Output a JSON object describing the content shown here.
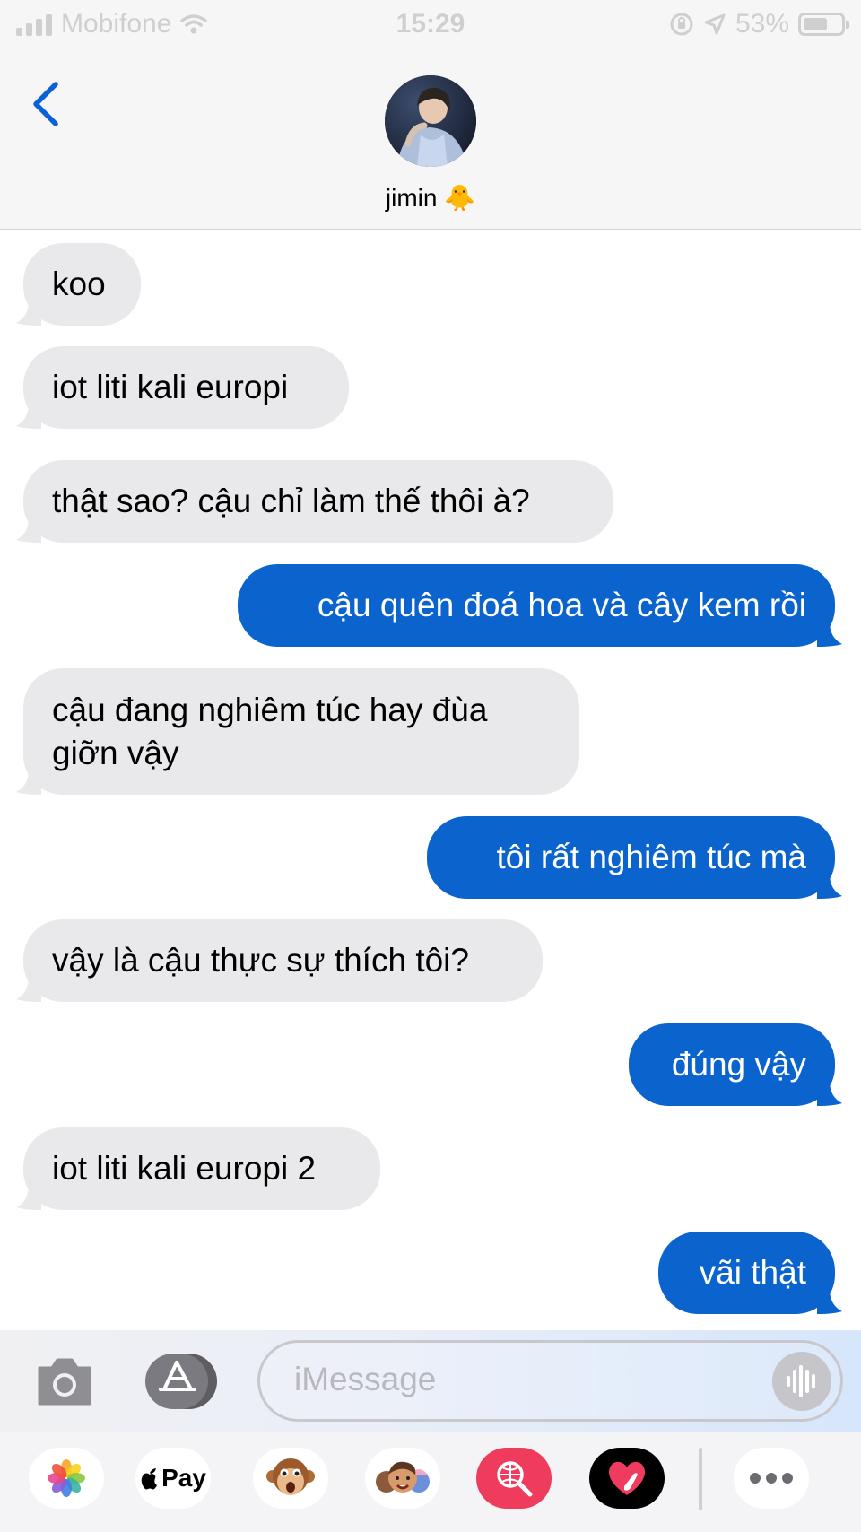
{
  "status_bar": {
    "carrier": "Mobifone",
    "time": "15:29",
    "battery": "53%"
  },
  "header": {
    "contact_name": "jimin 🐥"
  },
  "messages": [
    {
      "direction": "incoming",
      "text": "koo"
    },
    {
      "direction": "incoming",
      "text": "iot liti kali europi"
    },
    {
      "direction": "incoming",
      "text": "thật sao? cậu chỉ làm thế thôi à?"
    },
    {
      "direction": "outgoing",
      "text": "cậu quên đoá hoa và cây kem rồi"
    },
    {
      "direction": "incoming",
      "line1": "cậu đang nghiêm túc hay đùa",
      "line2": "giỡn vậy"
    },
    {
      "direction": "outgoing",
      "text": "tôi rất nghiêm túc mà"
    },
    {
      "direction": "incoming",
      "text": "vậy là cậu thực sự thích tôi?"
    },
    {
      "direction": "outgoing",
      "text": "đúng vậy"
    },
    {
      "direction": "incoming",
      "text": "iot liti kali europi 2"
    },
    {
      "direction": "outgoing",
      "text": "vãi thật"
    }
  ],
  "input": {
    "placeholder": "iMessage"
  },
  "apps": {
    "apple_pay_label": "Pay",
    "items": [
      "photos",
      "apple-pay",
      "animoji",
      "memoji",
      "web-search",
      "digital-touch",
      "more"
    ]
  },
  "colors": {
    "outgoing_bubble": "#0b63ce",
    "incoming_bubble": "#e9e9eb",
    "accent": "#0a60d6"
  }
}
